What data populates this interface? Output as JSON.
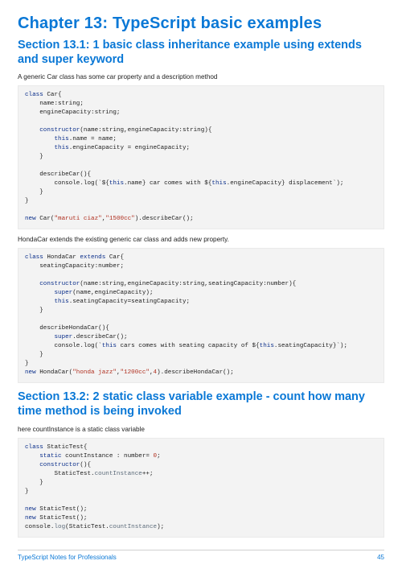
{
  "chapter": {
    "title": "Chapter 13: TypeScript basic examples"
  },
  "section131": {
    "heading": "Section 13.1: 1 basic class inheritance example using extends and super keyword",
    "intro": "A generic Car class has some car property and a description method",
    "between": "HondaCar extends the existing generic car class and adds new property."
  },
  "section132": {
    "heading": "Section 13.2: 2 static class variable example - count how many time method is being invoked",
    "intro": "here countInstance is a static class variable"
  },
  "code": {
    "car": {
      "l01a": "class",
      "l01b": " Car{",
      "l02": "    name:string;",
      "l03": "    engineCapacity:string;",
      "l05a": "    constructor",
      "l05b": "(name:string,engineCapacity:string){",
      "l06a": "        this",
      "l06b": ".name = name;",
      "l07a": "        this",
      "l07b": ".engineCapacity = engineCapacity;",
      "l08": "    }",
      "l10": "    describeCar(){",
      "l11a": "        console.log(`${",
      "l11b": "this",
      "l11c": ".name} car comes with ${",
      "l11d": "this",
      "l11e": ".engineCapacity} displacement`);",
      "l12": "    }",
      "l13": "}",
      "l15a": "new",
      "l15b": " Car(",
      "l15c": "\"maruti ciaz\"",
      "l15d": ",",
      "l15e": "\"1500cc\"",
      "l15f": ").describeCar();"
    },
    "honda": {
      "l01a": "class",
      "l01b": " HondaCar ",
      "l01c": "extends",
      "l01d": " Car{",
      "l02": "    seatingCapacity:number;",
      "l04a": "    constructor",
      "l04b": "(name:string,engineCapacity:string,seatingCapacity:number){",
      "l05a": "        super",
      "l05b": "(name,engineCapacity);",
      "l06a": "        this",
      "l06b": ".seatingCapacity=seatingCapacity;",
      "l07": "    }",
      "l09": "    describeHondaCar(){",
      "l10a": "        super",
      "l10b": ".describeCar();",
      "l11a": "        console.log(`",
      "l11b": "this",
      "l11c": " cars comes with seating capacity of ${",
      "l11d": "this",
      "l11e": ".seatingCapacity}`);",
      "l12": "    }",
      "l13": "}",
      "l14a": "new",
      "l14b": " HondaCar(",
      "l14c": "\"honda jazz\"",
      "l14d": ",",
      "l14e": "\"1200cc\"",
      "l14f": ",",
      "l14g": "4",
      "l14h": ").describeHondaCar();"
    },
    "staticTest": {
      "l01a": "class",
      "l01b": " StaticTest{",
      "l02a": "    static",
      "l02b": " countInstance : number= ",
      "l02c": "0",
      "l02d": ";",
      "l03a": "    constructor",
      "l03b": "(){",
      "l04a": "        StaticTest.",
      "l04b": "countInstance",
      "l04c": "++;",
      "l05": "    }",
      "l06": "}",
      "l08a": "new",
      "l08b": " StaticTest();",
      "l09a": "new",
      "l09b": " StaticTest();",
      "l10a": "console.",
      "l10b": "log",
      "l10c": "(StaticTest.",
      "l10d": "countInstance",
      "l10e": ");"
    }
  },
  "footer": {
    "left": "TypeScript Notes for Professionals",
    "pageNumber": "45"
  }
}
